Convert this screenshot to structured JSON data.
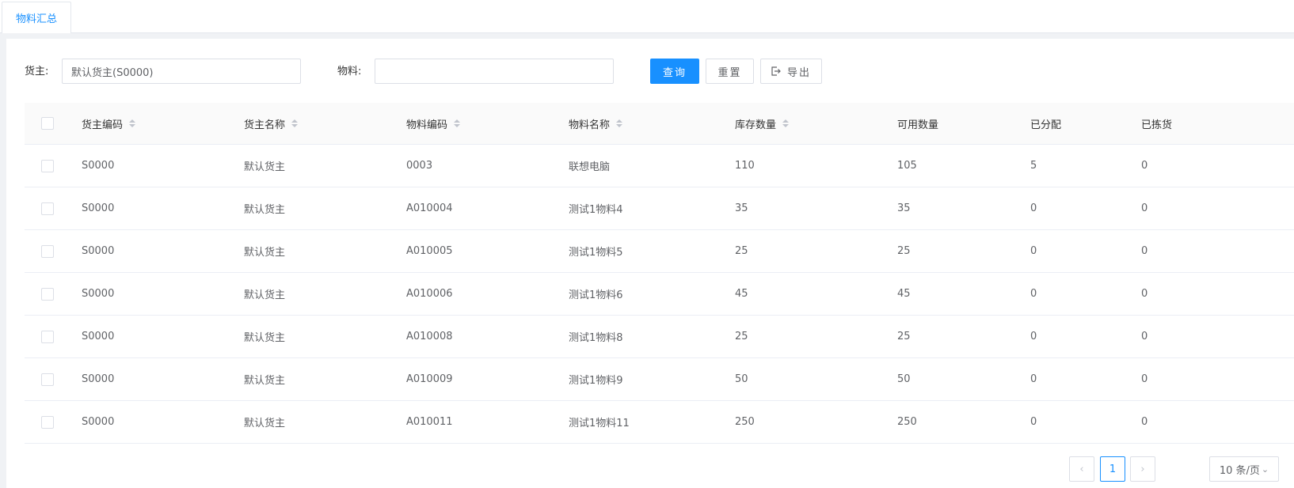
{
  "tabs": [
    {
      "label": "物料汇总"
    }
  ],
  "search": {
    "owner_label": "货主:",
    "owner_value": "默认货主(S0000)",
    "material_label": "物料:",
    "material_value": "",
    "query_label": "查询",
    "reset_label": "重置",
    "export_label": "导出"
  },
  "table": {
    "columns": [
      "货主编码",
      "货主名称",
      "物料编码",
      "物料名称",
      "库存数量",
      "可用数量",
      "已分配",
      "已拣货"
    ],
    "sortable": [
      true,
      true,
      true,
      true,
      true,
      false,
      false,
      false
    ],
    "rows": [
      [
        "S0000",
        "默认货主",
        "0003",
        "联想电脑",
        "110",
        "105",
        "5",
        "0"
      ],
      [
        "S0000",
        "默认货主",
        "A010004",
        "测试1物料4",
        "35",
        "35",
        "0",
        "0"
      ],
      [
        "S0000",
        "默认货主",
        "A010005",
        "测试1物料5",
        "25",
        "25",
        "0",
        "0"
      ],
      [
        "S0000",
        "默认货主",
        "A010006",
        "测试1物料6",
        "45",
        "45",
        "0",
        "0"
      ],
      [
        "S0000",
        "默认货主",
        "A010008",
        "测试1物料8",
        "25",
        "25",
        "0",
        "0"
      ],
      [
        "S0000",
        "默认货主",
        "A010009",
        "测试1物料9",
        "50",
        "50",
        "0",
        "0"
      ],
      [
        "S0000",
        "默认货主",
        "A010011",
        "测试1物料11",
        "250",
        "250",
        "0",
        "0"
      ]
    ]
  },
  "pagination": {
    "current_page": "1",
    "page_size_label": "10 条/页"
  },
  "colors": {
    "primary": "#1890ff",
    "border": "#dcdfe6",
    "text": "#606266"
  }
}
